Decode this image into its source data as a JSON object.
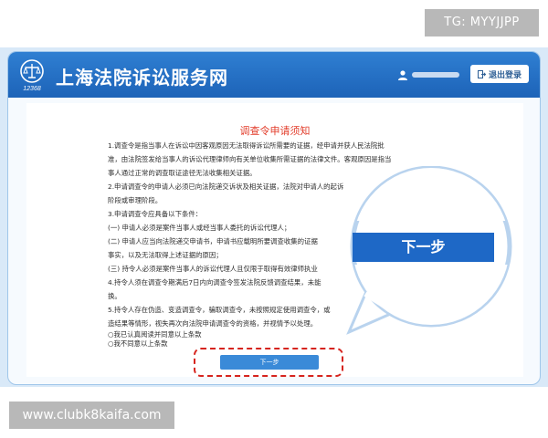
{
  "watermark": {
    "top": "TG: MYYJJPP",
    "bottom": "www.clubk8kaifa.com"
  },
  "header": {
    "logo_text": "12368",
    "title": "上海法院诉讼服务网",
    "logout_label": "退出登录"
  },
  "notice": {
    "title": "调查令申请须知",
    "lines": [
      "1.调查令是指当事人在诉讼中因客观原因无法取得诉讼所需要的证据，经申请并获人民法院批",
      "准，由法院签发给当事人的诉讼代理律师向有关单位收集所需证据的法律文件。客观原因是指当",
      "事人通过正常的调查取证途径无法收集相关证据。",
      "2.申请调查令的申请人必须已向法院递交诉状及相关证据，法院对申请人的起诉",
      "阶段或审理阶段。",
      "3.申请调查令应具备以下条件：",
      "(一) 申请人必须是案件当事人或经当事人委托的诉讼代理人；",
      "(二) 申请人应当向法院递交申请书，申请书应载明所要调查收集的证据",
      "事实，以及无法取得上述证据的原因；",
      "(三) 持令人必须是案件当事人的诉讼代理人且仅限于取得有效律师执业",
      "4.持令人须在调查令期满后7日内向调查令签发法院反馈调查结果，未能",
      "换。",
      "5.持令人存在伪造、变造调查令，骗取调查令，未按照规定使用调查令，或",
      "造结果等情形，视失再次向法院申请调查令的资格，并视情予以处理。"
    ],
    "options": [
      "○我已认真阅读并同意以上条款",
      "○我不同意以上条款"
    ],
    "next_label": "下一步"
  },
  "zoom": {
    "next_label": "下一步"
  },
  "colors": {
    "header_blue": "#1d63b8",
    "button_blue": "#3a8ad8",
    "title_red": "#e23c2a",
    "highlight_red": "#d6241e"
  }
}
